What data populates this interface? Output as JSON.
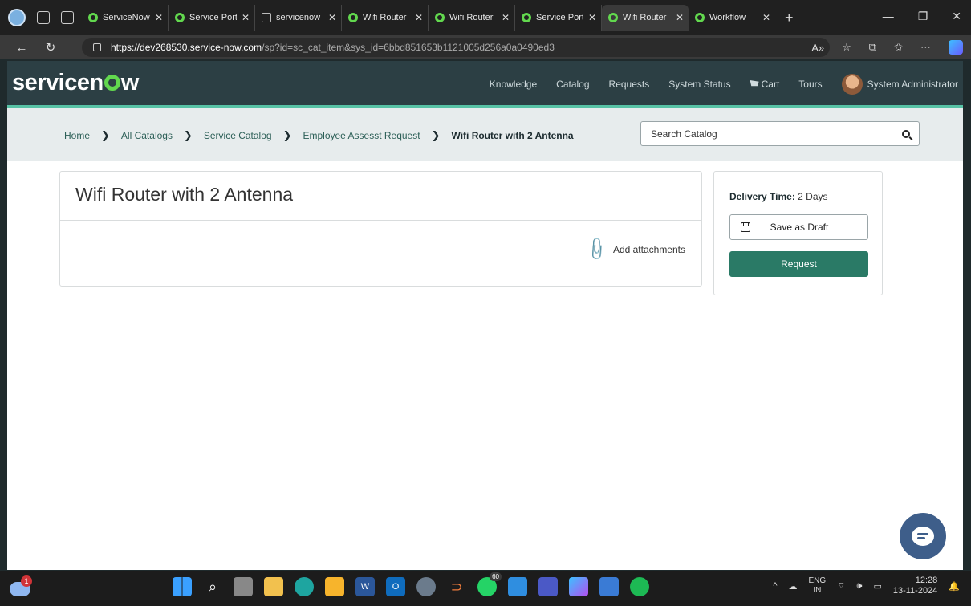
{
  "browser": {
    "tabs": [
      {
        "label": "ServiceNow",
        "active": false
      },
      {
        "label": "Service Portal",
        "active": false
      },
      {
        "label": "servicenow",
        "active": false
      },
      {
        "label": "Wifi Router",
        "active": false
      },
      {
        "label": "Wifi Router",
        "active": false
      },
      {
        "label": "Service Portal",
        "active": false
      },
      {
        "label": "Wifi Router",
        "active": true
      },
      {
        "label": "Workflow",
        "active": false
      }
    ],
    "url_host": "https://dev268530.service-now.com",
    "url_path": "/sp?id=sc_cat_item&sys_id=6bbd851653b1121005d256a0a0490ed3"
  },
  "header": {
    "logo": "servicenow",
    "nav": [
      "Knowledge",
      "Catalog",
      "Requests",
      "System Status",
      "Cart",
      "Tours"
    ],
    "user": "System Administrator"
  },
  "breadcrumb": {
    "items": [
      "Home",
      "All Catalogs",
      "Service Catalog",
      "Employee Assesst Request"
    ],
    "current": "Wifi Router with 2 Antenna"
  },
  "search": {
    "placeholder": "Search Catalog"
  },
  "item": {
    "title": "Wifi Router with 2 Antenna",
    "attachments_label": "Add attachments"
  },
  "order": {
    "delivery_label": "Delivery Time:",
    "delivery_value": "2 Days",
    "save_draft": "Save as Draft",
    "request": "Request"
  },
  "taskbar": {
    "weather_badge": "1",
    "whatsapp_badge": "60",
    "lang_top": "ENG",
    "lang_bottom": "IN",
    "time": "12:28",
    "date": "13-11-2024"
  },
  "colors": {
    "header_bg": "#2c3f44",
    "accent_green": "#62d84e",
    "request_btn": "#2a7a66",
    "chat_fab": "#3e5e8a"
  }
}
